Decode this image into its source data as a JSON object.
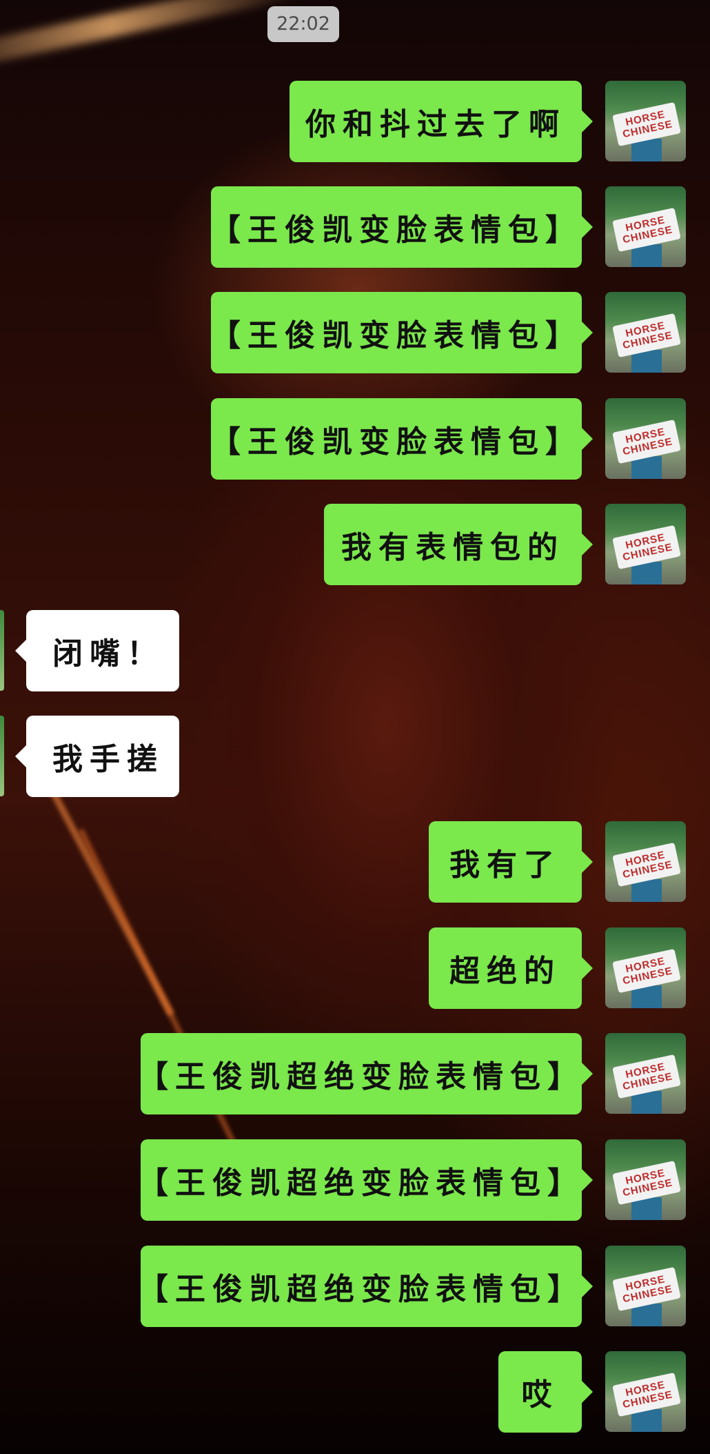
{
  "status": {
    "time": "22:02"
  },
  "messages": [
    {
      "side": "sent",
      "text": "你和抖过去了啊"
    },
    {
      "side": "sent",
      "text": "【王俊凯变脸表情包】"
    },
    {
      "side": "sent",
      "text": "【王俊凯变脸表情包】"
    },
    {
      "side": "sent",
      "text": "【王俊凯变脸表情包】"
    },
    {
      "side": "sent",
      "text": "我有表情包的"
    },
    {
      "side": "received",
      "text": "闭嘴！"
    },
    {
      "side": "received",
      "text": "我手搓"
    },
    {
      "side": "sent",
      "text": "我有了"
    },
    {
      "side": "sent",
      "text": "超绝的"
    },
    {
      "side": "sent",
      "text": "【王俊凯超绝变脸表情包】"
    },
    {
      "side": "sent",
      "text": "【王俊凯超绝变脸表情包】"
    },
    {
      "side": "sent",
      "text": "【王俊凯超绝变脸表情包】"
    },
    {
      "side": "sent",
      "text": "哎"
    }
  ],
  "avatar_sign_text": [
    "HORSE",
    "CHINESE"
  ],
  "colors": {
    "sent_bubble": "#7be84c",
    "received_bubble": "#ffffff",
    "time_badge": "#c8c8c8"
  }
}
